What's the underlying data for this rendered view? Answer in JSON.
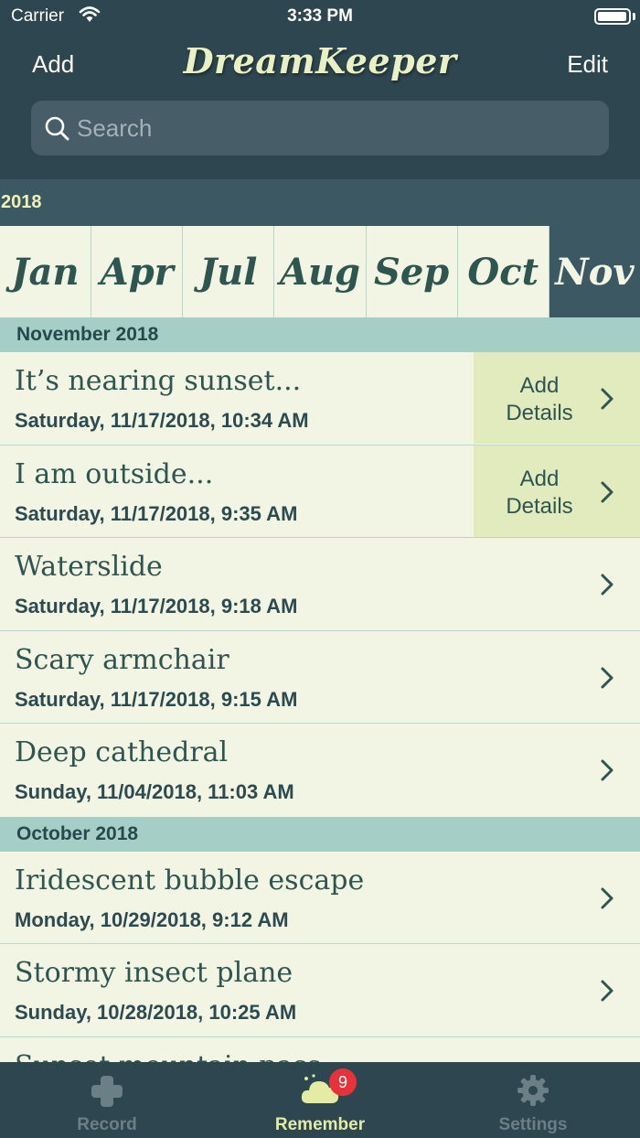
{
  "status_bar": {
    "carrier": "Carrier",
    "time": "3:33 PM"
  },
  "header": {
    "add_label": "Add",
    "app_title": "DreamKeeper",
    "edit_label": "Edit"
  },
  "search": {
    "placeholder": "Search"
  },
  "year": "2018",
  "months": [
    "Jan",
    "Apr",
    "Jul",
    "Aug",
    "Sep",
    "Oct",
    "Nov"
  ],
  "selected_month": "Nov",
  "sections": [
    {
      "header": "November 2018",
      "rows": [
        {
          "title": "It’s nearing sunset...",
          "date": "Saturday, 11/17/2018, 10:34 AM",
          "action": "Add\nDetails"
        },
        {
          "title": "I am outside...",
          "date": "Saturday, 11/17/2018, 9:35 AM",
          "action": "Add\nDetails"
        },
        {
          "title": "Waterslide",
          "date": "Saturday, 11/17/2018, 9:18 AM"
        },
        {
          "title": "Scary armchair",
          "date": "Saturday, 11/17/2018, 9:15 AM"
        },
        {
          "title": "Deep cathedral",
          "date": "Sunday, 11/04/2018, 11:03 AM"
        }
      ]
    },
    {
      "header": "October 2018",
      "rows": [
        {
          "title": "Iridescent bubble escape",
          "date": "Monday, 10/29/2018, 9:12 AM"
        },
        {
          "title": "Stormy insect plane",
          "date": "Sunday, 10/28/2018, 10:25 AM"
        },
        {
          "title": "Sunset mountain pass",
          "date": ""
        }
      ]
    }
  ],
  "tabbar": {
    "tabs": [
      {
        "label": "Record",
        "icon": "plus-icon"
      },
      {
        "label": "Remember",
        "icon": "cloud-icon",
        "badge": "9"
      },
      {
        "label": "Settings",
        "icon": "gear-icon"
      }
    ],
    "active": "Remember"
  },
  "colors": {
    "header_bg": "#2e4650",
    "accent": "#e3eba5",
    "row_bg": "#f3f5e4",
    "section_bg": "#a5cec7",
    "badge": "#e8323a"
  }
}
